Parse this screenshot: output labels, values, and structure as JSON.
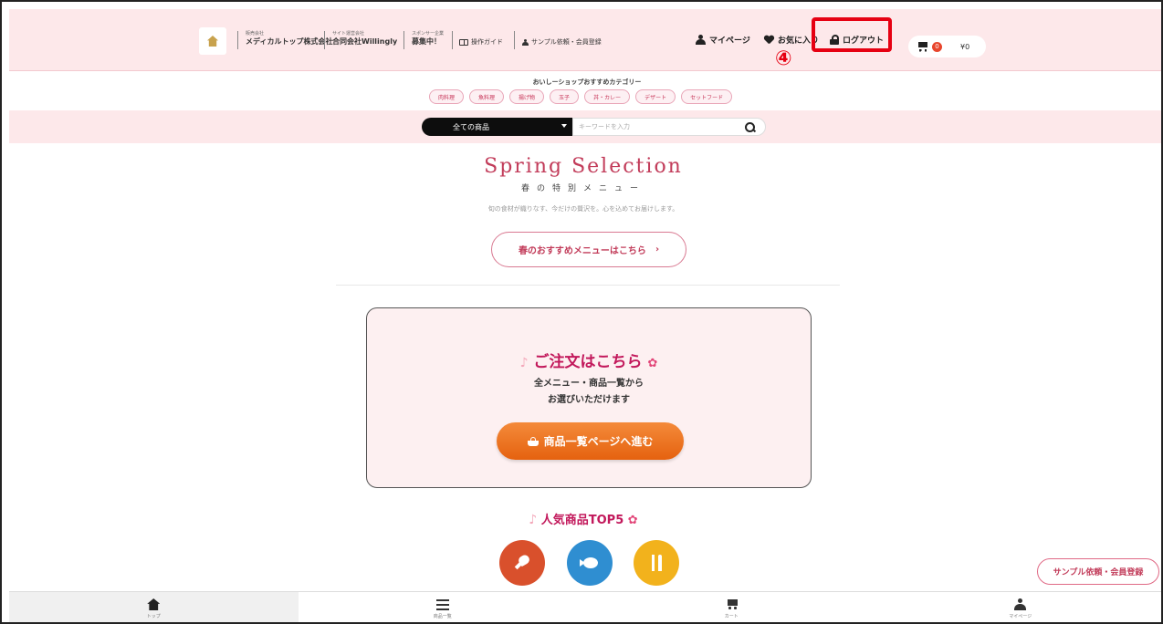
{
  "header": {
    "company1_small": "販売会社",
    "company1_name": "メディカルトップ株式会社",
    "company2_small": "サイト運営会社",
    "company2_name": "合同会社Willingly",
    "sponsor_small": "スポンサー企業",
    "sponsor_text": "募集中！",
    "guide_link": "操作ガイド",
    "sample_link": "サンプル依頼・会員登録",
    "mypage": "マイページ",
    "favorites": "お気に入り",
    "logout": "ログアウト",
    "cart_count": "0",
    "cart_price": "¥0"
  },
  "annotation": {
    "step_label": "④",
    "highlight_color": "#e60012"
  },
  "categories": {
    "title": "おいしーショップおすすめカテゴリー",
    "items": [
      "肉料理",
      "魚料理",
      "揚げ物",
      "玉子",
      "丼・カレー",
      "デザート",
      "セットフード"
    ]
  },
  "search": {
    "scope": "全ての商品",
    "placeholder": "キーワードを入力"
  },
  "hero": {
    "title": "Spring Selection",
    "subtitle": "春の特別メニュー",
    "description": "旬の食材が織りなす、今だけの贅沢を。心を込めてお届けします。",
    "button": "春のおすすめメニューはこちら",
    "button_arrow": "›"
  },
  "order": {
    "title": "ご注文はこちら",
    "line1": "全メニュー・商品一覧から",
    "line2": "お選びいただけます",
    "button": "商品一覧ページへ進む"
  },
  "popular": {
    "title": "人気商品TOP5",
    "icons": [
      "meat-icon",
      "fish-icon",
      "cutlery-icon"
    ],
    "colors": [
      "#d9502c",
      "#2f8ed1",
      "#f2b21c"
    ]
  },
  "sample_button": "サンプル依頼・会員登録",
  "bottom_nav": [
    {
      "label": "トップ",
      "icon": "home-icon"
    },
    {
      "label": "商品一覧",
      "icon": "list-icon"
    },
    {
      "label": "カート",
      "icon": "cart-icon"
    },
    {
      "label": "マイページ",
      "icon": "person-icon"
    }
  ],
  "colors": {
    "header_bg": "#fde8ea",
    "accent": "#c2185b",
    "order_button": "#f07a25"
  }
}
